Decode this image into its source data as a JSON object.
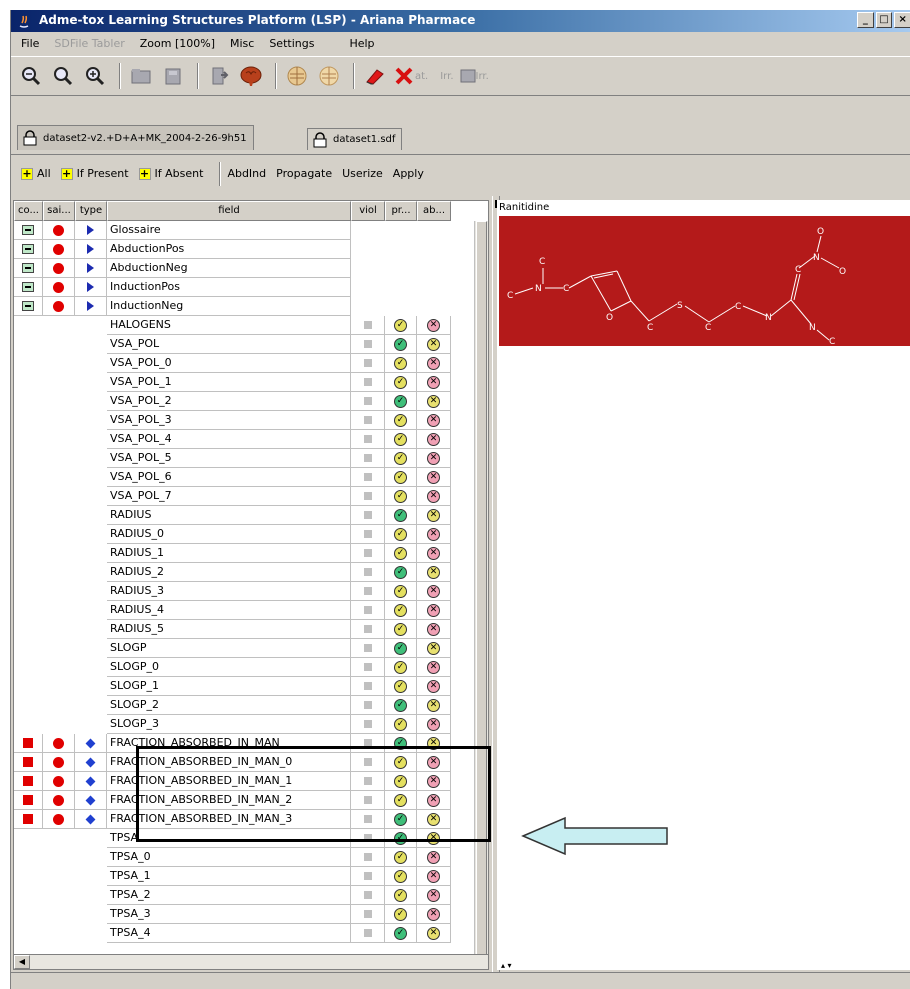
{
  "window": {
    "title": "Adme-tox Learning Structures Platform (LSP) - Ariana Pharmace",
    "min_label": "_",
    "max_label": "□",
    "close_label": "×"
  },
  "menu": {
    "file": "File",
    "sdfile": "SDFile Tabler",
    "zoom": "Zoom [100%]",
    "misc": "Misc",
    "settings": "Settings",
    "help": "Help"
  },
  "toolbar": {
    "label_rat": "at.",
    "label_irr": "Irr.",
    "label_irr2": "Irr."
  },
  "tabs": [
    {
      "label": "dataset2-v2.+D+A+MK_2004-2-26-9h51",
      "active": true
    },
    {
      "label": "dataset1.sdf",
      "active": false
    }
  ],
  "buttonbar": {
    "all": "All",
    "if_present": "If Present",
    "if_absent": "If Absent",
    "abdind": "AbdInd",
    "propagate": "Propagate",
    "userize": "Userize",
    "apply": "Apply"
  },
  "table": {
    "headers": {
      "co": "co...",
      "sai": "sai...",
      "type": "type",
      "field": "field",
      "viol": "viol",
      "pr": "pr...",
      "ab": "ab..."
    },
    "rows": [
      {
        "field": "Glossaire",
        "co": "minus",
        "sai": "reddot",
        "type": "tri",
        "viol": "",
        "pr": "",
        "ab": ""
      },
      {
        "field": "AbductionPos",
        "co": "minus",
        "sai": "reddot",
        "type": "tri",
        "viol": "",
        "pr": "",
        "ab": ""
      },
      {
        "field": "AbductionNeg",
        "co": "minus",
        "sai": "reddot",
        "type": "tri",
        "viol": "",
        "pr": "",
        "ab": ""
      },
      {
        "field": "InductionPos",
        "co": "minus",
        "sai": "reddot",
        "type": "tri",
        "viol": "",
        "pr": "",
        "ab": ""
      },
      {
        "field": "InductionNeg",
        "co": "minus",
        "sai": "reddot",
        "type": "tri",
        "viol": "",
        "pr": "",
        "ab": ""
      },
      {
        "field": "HALOGENS",
        "co": "",
        "sai": "",
        "type": "",
        "viol": "gray",
        "pr": "yellow",
        "ab": "pink"
      },
      {
        "field": "VSA_POL",
        "co": "",
        "sai": "",
        "type": "",
        "viol": "gray",
        "pr": "green",
        "ab": "yellow"
      },
      {
        "field": "VSA_POL_0",
        "co": "",
        "sai": "",
        "type": "",
        "viol": "gray",
        "pr": "yellow",
        "ab": "pink"
      },
      {
        "field": "VSA_POL_1",
        "co": "",
        "sai": "",
        "type": "",
        "viol": "gray",
        "pr": "yellow",
        "ab": "pink"
      },
      {
        "field": "VSA_POL_2",
        "co": "",
        "sai": "",
        "type": "",
        "viol": "gray",
        "pr": "green",
        "ab": "yellow"
      },
      {
        "field": "VSA_POL_3",
        "co": "",
        "sai": "",
        "type": "",
        "viol": "gray",
        "pr": "yellow",
        "ab": "pink"
      },
      {
        "field": "VSA_POL_4",
        "co": "",
        "sai": "",
        "type": "",
        "viol": "gray",
        "pr": "yellow",
        "ab": "pink"
      },
      {
        "field": "VSA_POL_5",
        "co": "",
        "sai": "",
        "type": "",
        "viol": "gray",
        "pr": "yellow",
        "ab": "pink"
      },
      {
        "field": "VSA_POL_6",
        "co": "",
        "sai": "",
        "type": "",
        "viol": "gray",
        "pr": "yellow",
        "ab": "pink"
      },
      {
        "field": "VSA_POL_7",
        "co": "",
        "sai": "",
        "type": "",
        "viol": "gray",
        "pr": "yellow",
        "ab": "pink"
      },
      {
        "field": "RADIUS",
        "co": "",
        "sai": "",
        "type": "",
        "viol": "gray",
        "pr": "green",
        "ab": "yellow"
      },
      {
        "field": "RADIUS_0",
        "co": "",
        "sai": "",
        "type": "",
        "viol": "gray",
        "pr": "yellow",
        "ab": "pink"
      },
      {
        "field": "RADIUS_1",
        "co": "",
        "sai": "",
        "type": "",
        "viol": "gray",
        "pr": "yellow",
        "ab": "pink"
      },
      {
        "field": "RADIUS_2",
        "co": "",
        "sai": "",
        "type": "",
        "viol": "gray",
        "pr": "green",
        "ab": "yellow"
      },
      {
        "field": "RADIUS_3",
        "co": "",
        "sai": "",
        "type": "",
        "viol": "gray",
        "pr": "yellow",
        "ab": "pink"
      },
      {
        "field": "RADIUS_4",
        "co": "",
        "sai": "",
        "type": "",
        "viol": "gray",
        "pr": "yellow",
        "ab": "pink"
      },
      {
        "field": "RADIUS_5",
        "co": "",
        "sai": "",
        "type": "",
        "viol": "gray",
        "pr": "yellow",
        "ab": "pink"
      },
      {
        "field": "SLOGP",
        "co": "",
        "sai": "",
        "type": "",
        "viol": "gray",
        "pr": "green",
        "ab": "yellow"
      },
      {
        "field": "SLOGP_0",
        "co": "",
        "sai": "",
        "type": "",
        "viol": "gray",
        "pr": "yellow",
        "ab": "pink"
      },
      {
        "field": "SLOGP_1",
        "co": "",
        "sai": "",
        "type": "",
        "viol": "gray",
        "pr": "yellow",
        "ab": "pink"
      },
      {
        "field": "SLOGP_2",
        "co": "",
        "sai": "",
        "type": "",
        "viol": "gray",
        "pr": "green",
        "ab": "yellow"
      },
      {
        "field": "SLOGP_3",
        "co": "",
        "sai": "",
        "type": "",
        "viol": "gray",
        "pr": "yellow",
        "ab": "pink"
      },
      {
        "field": "FRACTION_ABSORBED_IN_MAN",
        "co": "redsq",
        "sai": "reddot",
        "type": "diamond",
        "viol": "gray",
        "pr": "green",
        "ab": "yellow"
      },
      {
        "field": "FRACTION_ABSORBED_IN_MAN_0",
        "co": "redsq",
        "sai": "reddot",
        "type": "diamond",
        "viol": "gray",
        "pr": "yellow",
        "ab": "pink"
      },
      {
        "field": "FRACTION_ABSORBED_IN_MAN_1",
        "co": "redsq",
        "sai": "reddot",
        "type": "diamond",
        "viol": "gray",
        "pr": "yellow",
        "ab": "pink"
      },
      {
        "field": "FRACTION_ABSORBED_IN_MAN_2",
        "co": "redsq",
        "sai": "reddot",
        "type": "diamond",
        "viol": "gray",
        "pr": "yellow",
        "ab": "pink"
      },
      {
        "field": "FRACTION_ABSORBED_IN_MAN_3",
        "co": "redsq",
        "sai": "reddot",
        "type": "diamond",
        "viol": "gray",
        "pr": "green",
        "ab": "yellow"
      },
      {
        "field": "TPSA",
        "co": "",
        "sai": "",
        "type": "",
        "viol": "gray",
        "pr": "green",
        "ab": "yellow"
      },
      {
        "field": "TPSA_0",
        "co": "",
        "sai": "",
        "type": "",
        "viol": "gray",
        "pr": "yellow",
        "ab": "pink"
      },
      {
        "field": "TPSA_1",
        "co": "",
        "sai": "",
        "type": "",
        "viol": "gray",
        "pr": "yellow",
        "ab": "pink"
      },
      {
        "field": "TPSA_2",
        "co": "",
        "sai": "",
        "type": "",
        "viol": "gray",
        "pr": "yellow",
        "ab": "pink"
      },
      {
        "field": "TPSA_3",
        "co": "",
        "sai": "",
        "type": "",
        "viol": "gray",
        "pr": "yellow",
        "ab": "pink"
      },
      {
        "field": "TPSA_4",
        "co": "",
        "sai": "",
        "type": "",
        "viol": "gray",
        "pr": "green",
        "ab": "yellow"
      }
    ]
  },
  "molecule": {
    "name": "Ranitidine",
    "background": "#b41a1a",
    "atoms": [
      "C",
      "N",
      "C",
      "C",
      "O",
      "C",
      "S",
      "C",
      "N",
      "C",
      "N",
      "C",
      "O",
      "O"
    ]
  },
  "right_scroll": "▴ ▾"
}
